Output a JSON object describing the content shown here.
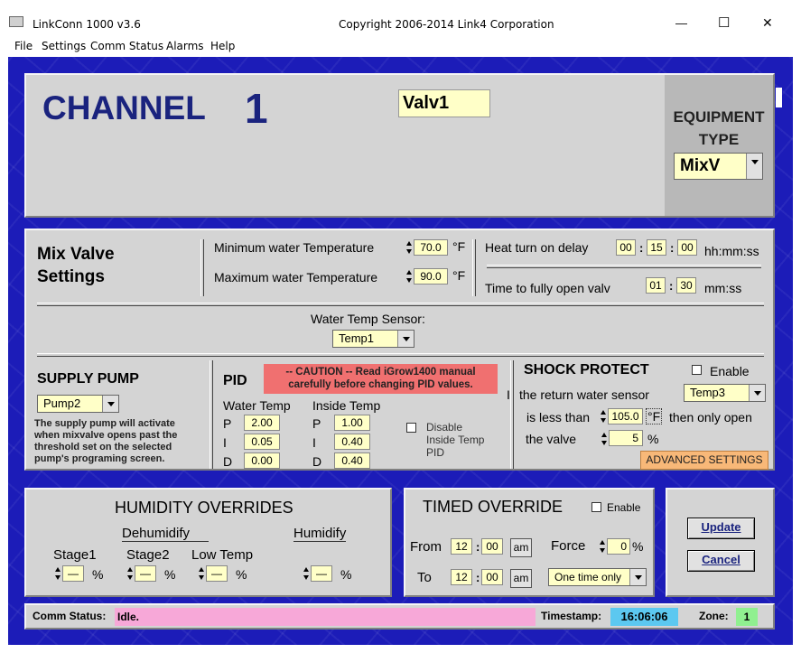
{
  "window": {
    "title": "LinkConn 1000 v3.6",
    "copyright": "Copyright 2006-2014 Link4 Corporation",
    "minimize": "—",
    "maximize": "☐",
    "close": "✕"
  },
  "menu": [
    "File",
    "Settings",
    "Comm Status",
    "Alarms",
    "Help"
  ],
  "header": {
    "channel_label": "CHANNEL",
    "channel_num": "1",
    "name": "Valv1",
    "equip_type_label": "EQUIPMENT TYPE",
    "equip_type": "MixV"
  },
  "mixvalve": {
    "title_line1": "Mix Valve",
    "title_line2": "Settings",
    "min_label": "Minimum water Temperature",
    "min_value": "70.0",
    "max_label": "Maximum water Temperature",
    "max_value": "90.0",
    "unit_f": "°F",
    "heat_delay_label": "Heat turn on delay",
    "heat_h": "00",
    "heat_m": "15",
    "heat_s": "00",
    "hhmmss": "hh:mm:ss",
    "open_label": "Time to fully open valv",
    "open_m": "01",
    "open_s": "30",
    "mmss": "mm:ss",
    "colon": ":"
  },
  "sensor": {
    "label": "Water Temp Sensor:",
    "value": "Temp1"
  },
  "supply": {
    "title": "SUPPLY PUMP",
    "value": "Pump2",
    "desc": "The supply pump will activate when mixvalve opens past the threshold set on the selected pump's programing screen."
  },
  "pid": {
    "title": "PID",
    "caution_line1": "-- CAUTION --   Read iGrow1400 manual",
    "caution_line2": "carefully before changing PID values.",
    "water_label": "Water Temp",
    "inside_label": "Inside Temp",
    "p": "P",
    "i": "I",
    "d": "D",
    "wp": "2.00",
    "wi": "0.05",
    "wd": "0.00",
    "ip": "1.00",
    "ii": "0.40",
    "id": "0.40",
    "disable_line1": "Disable",
    "disable_line2": "Inside Temp",
    "disable_line3": "PID"
  },
  "shock": {
    "title": "SHOCK PROTECT",
    "enable": "Enable",
    "sensor_label": "the return water sensor",
    "sensor_prefix": "I",
    "sensor": "Temp3",
    "less_label": "is less than",
    "temp": "105.0",
    "unit": "°F",
    "then_label": "then only open",
    "valve_label": "the valve",
    "pct": "5",
    "pct_unit": "%",
    "advanced": "ADVANCED SETTINGS"
  },
  "humidity": {
    "title": "HUMIDITY OVERRIDES",
    "dehum": "Dehumidify",
    "hum": "Humidify",
    "stage1": "Stage1",
    "stage2": "Stage2",
    "lowtemp": "Low Temp",
    "dash": "—",
    "pct": "%"
  },
  "timed": {
    "title": "TIMED OVERRIDE",
    "enable": "Enable",
    "from": "From",
    "to": "To",
    "from_h": "12",
    "from_m": "00",
    "from_ampm": "am",
    "to_h": "12",
    "to_m": "00",
    "to_ampm": "am",
    "force": "Force",
    "force_val": "0",
    "pct": "%",
    "mode": "One time only",
    "colon": ":"
  },
  "actions": {
    "update": "Update",
    "cancel": "Cancel"
  },
  "status": {
    "comm_label": "Comm Status:",
    "comm_value": "Idle.",
    "ts_label": "Timestamp:",
    "ts_value": "16:06:06",
    "zone_label": "Zone:",
    "zone_value": "1"
  }
}
